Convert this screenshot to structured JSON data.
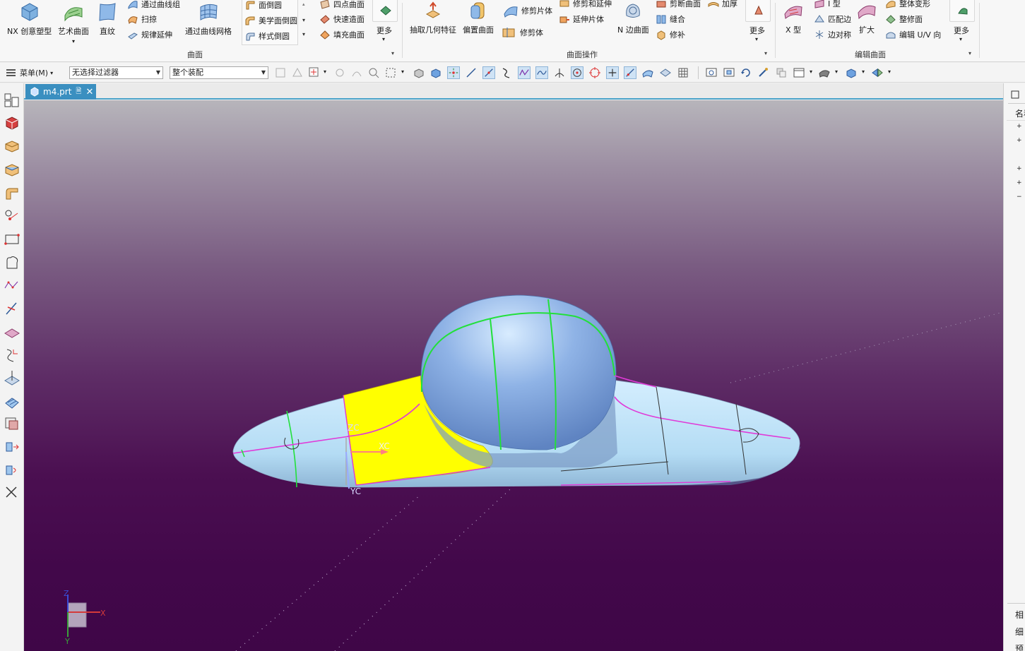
{
  "ribbon": {
    "create_surface": {
      "nx_realize": "NX 创意塑型",
      "studio_surface": "艺术曲面",
      "ruled": "直纹",
      "through_curves": "通过曲线组",
      "swept": "扫掠",
      "law_extension": "规律延伸",
      "through_curve_mesh": "通过曲线网格",
      "face_blend": "面倒圆",
      "aesthetic_face_blend": "美学面倒圆",
      "styled_blend": "样式倒圆",
      "four_point_surface": "四点曲面",
      "rapid_surfacing": "快速造面",
      "fill_surface": "填充曲面",
      "more": "更多",
      "group_label": "曲面"
    },
    "surface_ops": {
      "extract_geometry": "抽取几何特征",
      "offset_surface": "偏置曲面",
      "trim_sheet": "修剪片体",
      "trim_body": "修剪体",
      "trim_and_extend": "修剪和延伸",
      "extend_sheet": "延伸片体",
      "n_sided_surface": "N 边曲面",
      "divide_face": "剪断曲面",
      "sew": "缝合",
      "patch": "修补",
      "thicken": "加厚",
      "more": "更多",
      "group_label": "曲面操作"
    },
    "edit_surface": {
      "x_form": "X 型",
      "i_form": "I 型",
      "match_edge": "匹配边",
      "edge_symmetry": "边对称",
      "enlarge": "扩大",
      "global_shaping": "整体变形",
      "refit_face": "整修面",
      "edit_uv_direction": "编辑 U/V 向",
      "more": "更多",
      "group_label": "编辑曲面"
    }
  },
  "toolbar": {
    "menu_label": "菜单(M)",
    "filter_value": "无选择过滤器",
    "assembly_value": "整个装配"
  },
  "document": {
    "tab_name": "m4.prt"
  },
  "viewport": {
    "wcs_labels": {
      "zc": "ZC",
      "xc": "XC",
      "yc": "YC"
    },
    "triad_labels": {
      "z": "Z",
      "x": "X",
      "y": "Y"
    }
  },
  "right_panel": {
    "header": "名称",
    "bottom_items": [
      "相",
      "细",
      "预"
    ]
  },
  "colors": {
    "viewport_top": "#b7b5bb",
    "viewport_bottom": "#3f0647",
    "body_face": "#bfe3f7",
    "dome": "#8fb3e6",
    "selected_face": "#ffff00",
    "green_curve": "#22e03a",
    "magenta_curve": "#e03ad8",
    "tab_active": "#3a8fc0"
  }
}
